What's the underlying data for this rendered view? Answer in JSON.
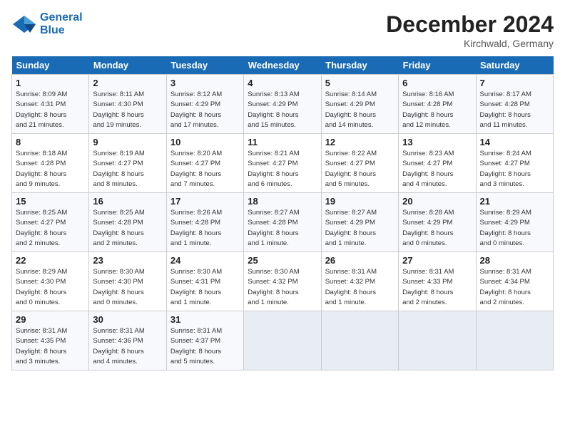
{
  "header": {
    "logo_line1": "General",
    "logo_line2": "Blue",
    "month": "December 2024",
    "location": "Kirchwald, Germany"
  },
  "weekdays": [
    "Sunday",
    "Monday",
    "Tuesday",
    "Wednesday",
    "Thursday",
    "Friday",
    "Saturday"
  ],
  "weeks": [
    [
      {
        "day": "1",
        "info": "Sunrise: 8:09 AM\nSunset: 4:31 PM\nDaylight: 8 hours\nand 21 minutes."
      },
      {
        "day": "2",
        "info": "Sunrise: 8:11 AM\nSunset: 4:30 PM\nDaylight: 8 hours\nand 19 minutes."
      },
      {
        "day": "3",
        "info": "Sunrise: 8:12 AM\nSunset: 4:29 PM\nDaylight: 8 hours\nand 17 minutes."
      },
      {
        "day": "4",
        "info": "Sunrise: 8:13 AM\nSunset: 4:29 PM\nDaylight: 8 hours\nand 15 minutes."
      },
      {
        "day": "5",
        "info": "Sunrise: 8:14 AM\nSunset: 4:29 PM\nDaylight: 8 hours\nand 14 minutes."
      },
      {
        "day": "6",
        "info": "Sunrise: 8:16 AM\nSunset: 4:28 PM\nDaylight: 8 hours\nand 12 minutes."
      },
      {
        "day": "7",
        "info": "Sunrise: 8:17 AM\nSunset: 4:28 PM\nDaylight: 8 hours\nand 11 minutes."
      }
    ],
    [
      {
        "day": "8",
        "info": "Sunrise: 8:18 AM\nSunset: 4:28 PM\nDaylight: 8 hours\nand 9 minutes."
      },
      {
        "day": "9",
        "info": "Sunrise: 8:19 AM\nSunset: 4:27 PM\nDaylight: 8 hours\nand 8 minutes."
      },
      {
        "day": "10",
        "info": "Sunrise: 8:20 AM\nSunset: 4:27 PM\nDaylight: 8 hours\nand 7 minutes."
      },
      {
        "day": "11",
        "info": "Sunrise: 8:21 AM\nSunset: 4:27 PM\nDaylight: 8 hours\nand 6 minutes."
      },
      {
        "day": "12",
        "info": "Sunrise: 8:22 AM\nSunset: 4:27 PM\nDaylight: 8 hours\nand 5 minutes."
      },
      {
        "day": "13",
        "info": "Sunrise: 8:23 AM\nSunset: 4:27 PM\nDaylight: 8 hours\nand 4 minutes."
      },
      {
        "day": "14",
        "info": "Sunrise: 8:24 AM\nSunset: 4:27 PM\nDaylight: 8 hours\nand 3 minutes."
      }
    ],
    [
      {
        "day": "15",
        "info": "Sunrise: 8:25 AM\nSunset: 4:27 PM\nDaylight: 8 hours\nand 2 minutes."
      },
      {
        "day": "16",
        "info": "Sunrise: 8:25 AM\nSunset: 4:28 PM\nDaylight: 8 hours\nand 2 minutes."
      },
      {
        "day": "17",
        "info": "Sunrise: 8:26 AM\nSunset: 4:28 PM\nDaylight: 8 hours\nand 1 minute."
      },
      {
        "day": "18",
        "info": "Sunrise: 8:27 AM\nSunset: 4:28 PM\nDaylight: 8 hours\nand 1 minute."
      },
      {
        "day": "19",
        "info": "Sunrise: 8:27 AM\nSunset: 4:29 PM\nDaylight: 8 hours\nand 1 minute."
      },
      {
        "day": "20",
        "info": "Sunrise: 8:28 AM\nSunset: 4:29 PM\nDaylight: 8 hours\nand 0 minutes."
      },
      {
        "day": "21",
        "info": "Sunrise: 8:29 AM\nSunset: 4:29 PM\nDaylight: 8 hours\nand 0 minutes."
      }
    ],
    [
      {
        "day": "22",
        "info": "Sunrise: 8:29 AM\nSunset: 4:30 PM\nDaylight: 8 hours\nand 0 minutes."
      },
      {
        "day": "23",
        "info": "Sunrise: 8:30 AM\nSunset: 4:30 PM\nDaylight: 8 hours\nand 0 minutes."
      },
      {
        "day": "24",
        "info": "Sunrise: 8:30 AM\nSunset: 4:31 PM\nDaylight: 8 hours\nand 1 minute."
      },
      {
        "day": "25",
        "info": "Sunrise: 8:30 AM\nSunset: 4:32 PM\nDaylight: 8 hours\nand 1 minute."
      },
      {
        "day": "26",
        "info": "Sunrise: 8:31 AM\nSunset: 4:32 PM\nDaylight: 8 hours\nand 1 minute."
      },
      {
        "day": "27",
        "info": "Sunrise: 8:31 AM\nSunset: 4:33 PM\nDaylight: 8 hours\nand 2 minutes."
      },
      {
        "day": "28",
        "info": "Sunrise: 8:31 AM\nSunset: 4:34 PM\nDaylight: 8 hours\nand 2 minutes."
      }
    ],
    [
      {
        "day": "29",
        "info": "Sunrise: 8:31 AM\nSunset: 4:35 PM\nDaylight: 8 hours\nand 3 minutes."
      },
      {
        "day": "30",
        "info": "Sunrise: 8:31 AM\nSunset: 4:36 PM\nDaylight: 8 hours\nand 4 minutes."
      },
      {
        "day": "31",
        "info": "Sunrise: 8:31 AM\nSunset: 4:37 PM\nDaylight: 8 hours\nand 5 minutes."
      },
      {
        "day": "",
        "info": ""
      },
      {
        "day": "",
        "info": ""
      },
      {
        "day": "",
        "info": ""
      },
      {
        "day": "",
        "info": ""
      }
    ]
  ]
}
